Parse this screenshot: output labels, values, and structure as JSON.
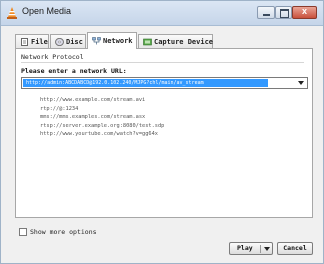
{
  "window": {
    "title": "Open Media",
    "close_glyph": "x"
  },
  "tabs": [
    {
      "label": "File",
      "icon": "file-icon"
    },
    {
      "label": "Disc",
      "icon": "disc-icon"
    },
    {
      "label": "Network",
      "icon": "network-icon",
      "active": true
    },
    {
      "label": "Capture Device",
      "icon": "capture-device-icon"
    }
  ],
  "network": {
    "group_title": "Network Protocol",
    "url_label": "Please enter a network URL:",
    "url_value": "http://admin:ABCDABCD@192.0.102.240/MJPG?chl/main/av_stream",
    "examples": [
      "http://www.example.com/stream.avi",
      "rtp://@:1234",
      "mms://mms.examples.com/stream.asx",
      "rtsp://server.example.org:8080/test.sdp",
      "http://www.yourtube.com/watch?v=gg64x"
    ]
  },
  "footer": {
    "show_more_label": "Show more options",
    "show_more_checked": false,
    "play_label": "Play",
    "cancel_label": "Cancel"
  },
  "colors": {
    "selection": "#3399ff",
    "close_button": "#c8503c"
  }
}
